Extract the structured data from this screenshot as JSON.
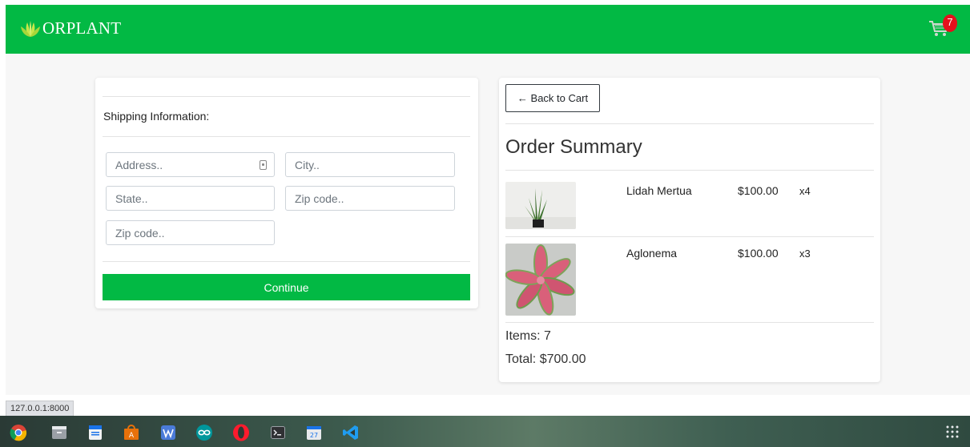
{
  "brand": {
    "name": "ORPLANT"
  },
  "cart": {
    "count": "7"
  },
  "shipping": {
    "title": "Shipping Information:",
    "address_placeholder": "Address..",
    "city_placeholder": "City..",
    "state_placeholder": "State..",
    "zip_placeholder": "Zip code..",
    "zip2_placeholder": "Zip code..",
    "continue_label": "Continue"
  },
  "summary": {
    "back_label": "← Back to Cart",
    "title": "Order Summary",
    "items": [
      {
        "name": "Lidah Mertua",
        "price": "$100.00",
        "qty": "x4"
      },
      {
        "name": "Aglonema",
        "price": "$100.00",
        "qty": "x3"
      }
    ],
    "items_count": "Items: 7",
    "total": "Total: $700.00"
  },
  "status_url": "127.0.0.1:8000",
  "colors": {
    "brand_green": "#02b944",
    "badge_red": "#e5101c"
  },
  "taskbar": {
    "apps": [
      "chrome-icon",
      "files-icon",
      "text-editor-icon",
      "software-center-icon",
      "wps-writer-icon",
      "arduino-icon",
      "opera-icon",
      "terminal-icon",
      "calendar-icon",
      "vscode-icon"
    ]
  }
}
